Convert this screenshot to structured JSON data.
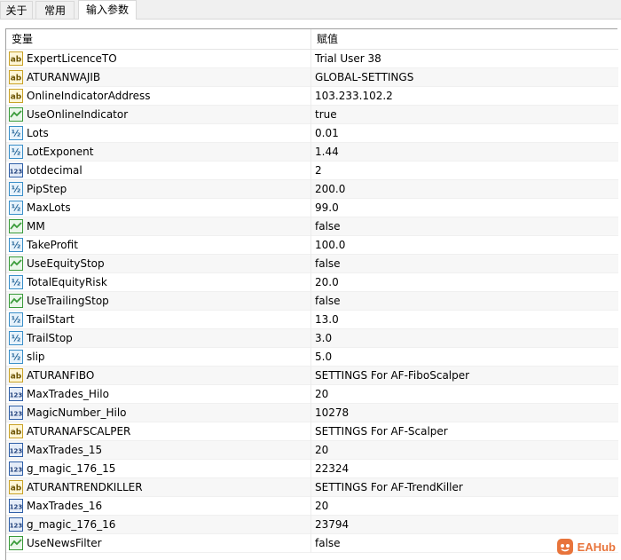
{
  "tabs": [
    {
      "label": "关于"
    },
    {
      "label": "常用"
    },
    {
      "label": "输入参数"
    }
  ],
  "table": {
    "col_variable": "变量",
    "col_value": "赋值",
    "rows": [
      {
        "icon": "string-icon",
        "name": "ExpertLicenceTO",
        "value": "Trial User 38"
      },
      {
        "icon": "string-icon",
        "name": "ATURANWAJIB",
        "value": "GLOBAL-SETTINGS"
      },
      {
        "icon": "string-icon",
        "name": "OnlineIndicatorAddress",
        "value": "103.233.102.2"
      },
      {
        "icon": "bool-icon",
        "name": "UseOnlineIndicator",
        "value": "true"
      },
      {
        "icon": "double-icon",
        "name": "Lots",
        "value": "0.01"
      },
      {
        "icon": "double-icon",
        "name": "LotExponent",
        "value": "1.44"
      },
      {
        "icon": "int-icon",
        "name": "lotdecimal",
        "value": "2"
      },
      {
        "icon": "double-icon",
        "name": "PipStep",
        "value": "200.0"
      },
      {
        "icon": "double-icon",
        "name": "MaxLots",
        "value": "99.0"
      },
      {
        "icon": "bool-icon",
        "name": "MM",
        "value": "false"
      },
      {
        "icon": "double-icon",
        "name": "TakeProfit",
        "value": "100.0"
      },
      {
        "icon": "bool-icon",
        "name": "UseEquityStop",
        "value": "false"
      },
      {
        "icon": "double-icon",
        "name": "TotalEquityRisk",
        "value": "20.0"
      },
      {
        "icon": "bool-icon",
        "name": "UseTrailingStop",
        "value": "false"
      },
      {
        "icon": "double-icon",
        "name": "TrailStart",
        "value": "13.0"
      },
      {
        "icon": "double-icon",
        "name": "TrailStop",
        "value": "3.0"
      },
      {
        "icon": "double-icon",
        "name": "slip",
        "value": "5.0"
      },
      {
        "icon": "string-icon",
        "name": "ATURANFIBO",
        "value": "SETTINGS For AF-FiboScalper"
      },
      {
        "icon": "int-icon",
        "name": "MaxTrades_Hilo",
        "value": "20"
      },
      {
        "icon": "int-icon",
        "name": "MagicNumber_Hilo",
        "value": "10278"
      },
      {
        "icon": "string-icon",
        "name": "ATURANAFSCALPER",
        "value": "SETTINGS For AF-Scalper"
      },
      {
        "icon": "int-icon",
        "name": "MaxTrades_15",
        "value": "20"
      },
      {
        "icon": "int-icon",
        "name": "g_magic_176_15",
        "value": "22324"
      },
      {
        "icon": "string-icon",
        "name": "ATURANTRENDKILLER",
        "value": "SETTINGS For AF-TrendKiller"
      },
      {
        "icon": "int-icon",
        "name": "MaxTrades_16",
        "value": "20"
      },
      {
        "icon": "int-icon",
        "name": "g_magic_176_16",
        "value": "23794"
      },
      {
        "icon": "bool-icon",
        "name": "UseNewsFilter",
        "value": "false"
      }
    ]
  },
  "icon_glyphs": {
    "string-icon": "ab",
    "double-icon": "½",
    "int-icon": "123"
  },
  "watermark": {
    "text": "EAHub"
  },
  "colors": {
    "accent": "#e8743b",
    "string_icon": "#c9a227",
    "bool_icon": "#3a9b3a",
    "double_icon": "#3a8fc9",
    "int_icon": "#2f5fa8"
  }
}
